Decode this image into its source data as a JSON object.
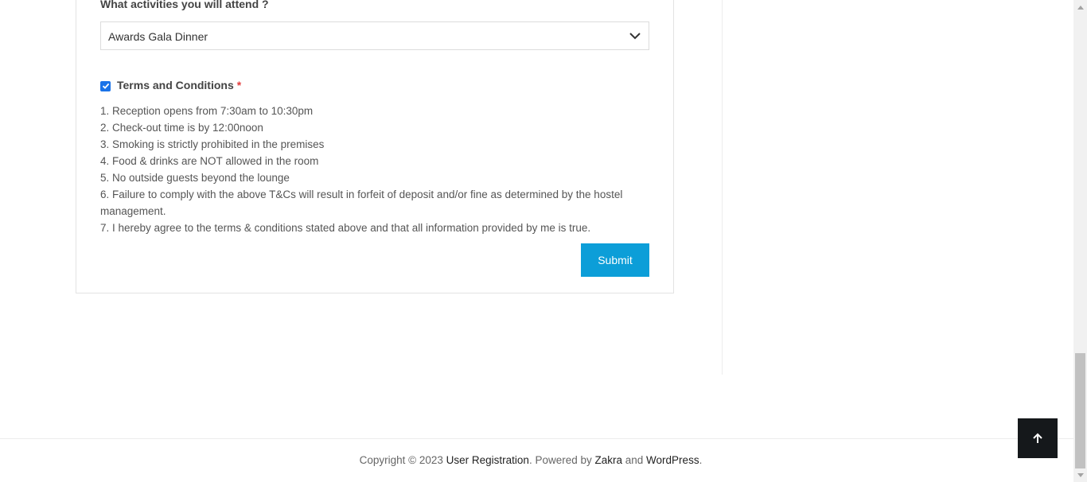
{
  "form": {
    "activities_label": "What activities you will attend ?",
    "activities_selected": "Awards Gala Dinner",
    "terms_label": "Terms and Conditions",
    "required_marker": "*",
    "terms_checked": true,
    "terms": [
      "1. Reception opens from 7:30am to 10:30pm",
      "2. Check-out time is by 12:00noon",
      "3. Smoking is strictly prohibited in the premises",
      "4. Food & drinks are NOT allowed in the room",
      "5. No outside guests beyond the lounge",
      "6. Failure to comply with the above T&Cs will result in forfeit of deposit and/or fine as determined by the hostel management.",
      "7. I hereby agree to the terms & conditions stated above and that all information provided by me is true."
    ],
    "submit_label": "Submit"
  },
  "footer": {
    "prefix": "Copyright © 2023 ",
    "site_link": "User Registration",
    "powered": ". Powered by ",
    "theme_link": "Zakra",
    "and": " and ",
    "wp_link": "WordPress",
    "suffix": "."
  },
  "icons": {
    "chevron": "chevron-down-icon",
    "check": "check-icon",
    "back_to_top": "arrow-up-icon"
  },
  "colors": {
    "accent": "#0c9ed8",
    "checkbox": "#1a73e8",
    "required": "#e23d3d",
    "back_to_top_bg": "#15181b"
  }
}
